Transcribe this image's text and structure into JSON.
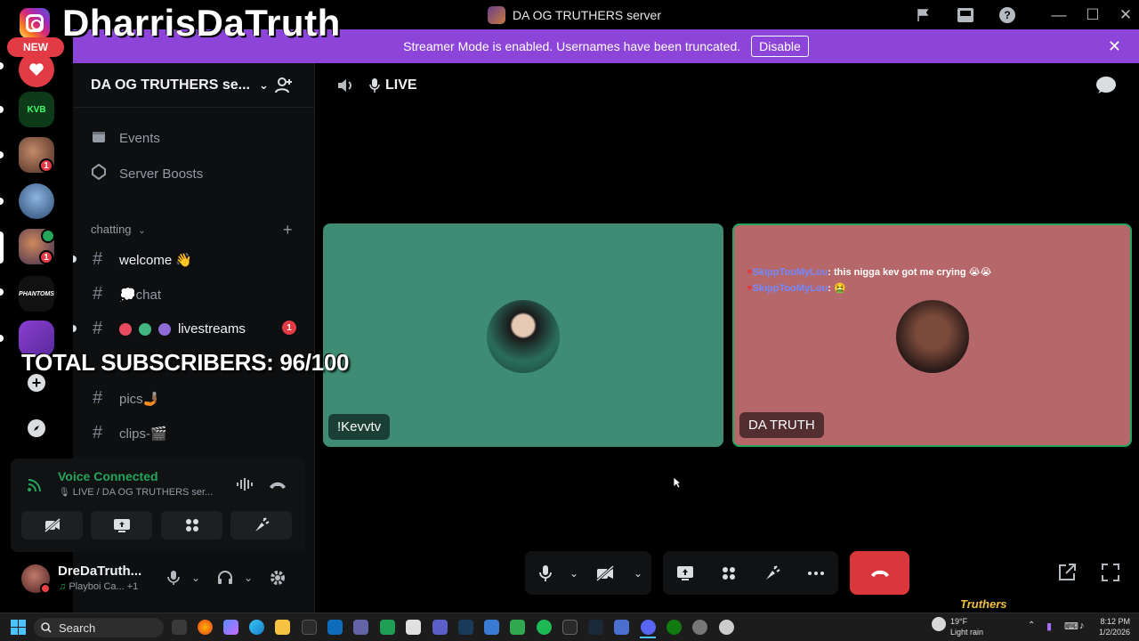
{
  "streamer": {
    "handle": "DharrisDaTruth",
    "subscribers": "TOTAL SUBSCRIBERS: 96/100",
    "watermark": "Truthers"
  },
  "titlebar": {
    "server_name": "DA OG TRUTHERS server"
  },
  "banner": {
    "message": "Streamer Mode is enabled. Usernames have been truncated.",
    "disable_label": "Disable"
  },
  "rail": {
    "new_label": "NEW",
    "badges": [
      "1",
      "1"
    ],
    "kvb_label": "KVB",
    "phantoms_label": "PHANTOMS"
  },
  "sidebar": {
    "server_title": "DA OG TRUTHERS se...",
    "events_label": "Events",
    "boosts_label": "Server Boosts",
    "category": "chatting",
    "channels": [
      {
        "name": "welcome 👋"
      },
      {
        "name": "💭chat"
      },
      {
        "name": "livestreams",
        "badge": "1"
      },
      {
        "name": "pics🤳🏾"
      },
      {
        "name": "clips-🎬"
      }
    ]
  },
  "voice": {
    "status": "Voice Connected",
    "location": "LIVE / DA OG TRUTHERS ser..."
  },
  "user": {
    "name": "DreDaTruth...",
    "activity": "Playboi Ca...",
    "activity_more": "+1"
  },
  "main": {
    "channel_name": "LIVE",
    "tiles": [
      {
        "label": "!Kevvtv",
        "bg": "#3d8c73"
      },
      {
        "label": "DA TRUTH",
        "bg": "#b5676a",
        "chat": [
          {
            "user": "SkippTooMyLou",
            "text": "this nigga kev got me crying 😭😭"
          },
          {
            "user": "SkippTooMyLou",
            "text": "🤮"
          }
        ]
      }
    ]
  },
  "taskbar": {
    "search_placeholder": "Search",
    "weather_temp": "19°F",
    "weather_desc": "Light rain",
    "time": "8:12 PM",
    "date": "1/2/2026"
  },
  "colors": {
    "accent": "#8c44d9",
    "green": "#23a55a",
    "danger": "#da373c"
  }
}
